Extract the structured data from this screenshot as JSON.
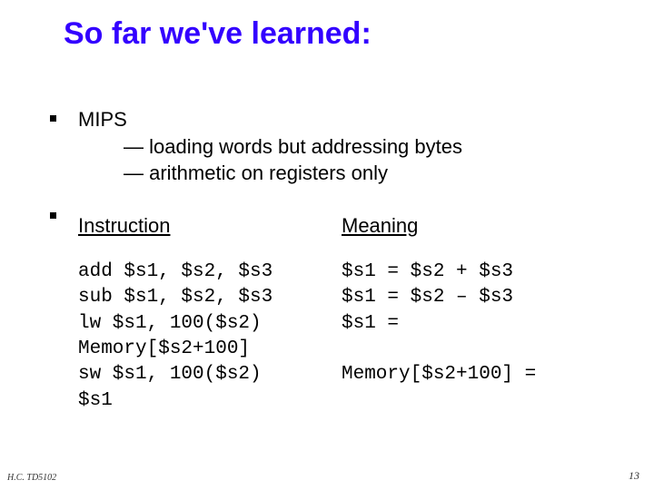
{
  "title": "So far we've learned:",
  "bullet1": {
    "head": "MIPS",
    "line1": "— loading words but addressing bytes",
    "line2": "— arithmetic on registers only"
  },
  "table": {
    "head_left": "Instruction",
    "head_right": "Meaning",
    "left_block": "add $s1, $s2, $s3\nsub $s1, $s2, $s3\nlw $s1, 100($s2)\nMemory[$s2+100]\nsw $s1, 100($s2)\n$s1",
    "right_block": "$s1 = $s2 + $s3\n$s1 = $s2 – $s3\n$s1 =\n\nMemory[$s2+100] ="
  },
  "footer": {
    "left": "H.C. TD5102",
    "right": "13"
  }
}
